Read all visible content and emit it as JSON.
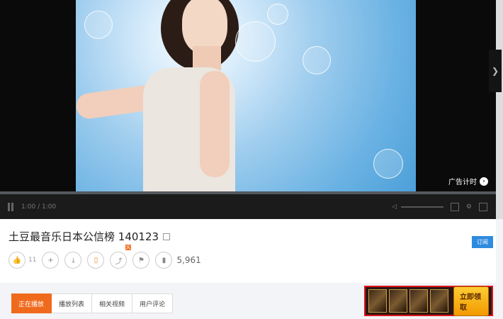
{
  "player": {
    "time": "1:00 / 1:00",
    "progress_fraction": 0.0,
    "watermark": "广告计时",
    "side_arrow": "❯"
  },
  "info": {
    "title": "土豆最音乐日本公信榜 140123",
    "badge": "火",
    "like_count": "11",
    "views": "5,961",
    "subscribe_label": "订阅"
  },
  "tabs": [
    {
      "label": "正在播放"
    },
    {
      "label": "播放列表"
    },
    {
      "label": "相关视频"
    },
    {
      "label": "用户评论"
    }
  ],
  "ad": {
    "cta": "立即领取"
  },
  "colors": {
    "accent": "#f06a1d",
    "ad_border": "#e0131a",
    "subscribe": "#2f8be0"
  }
}
